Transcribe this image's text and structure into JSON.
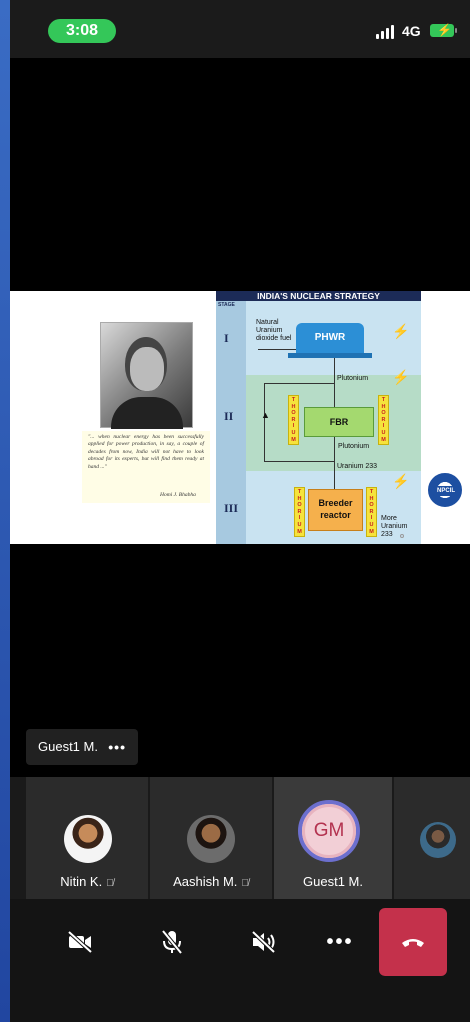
{
  "status_bar": {
    "time": "3:08",
    "network": "4G",
    "icons": [
      "signal-icon",
      "battery-charging-icon"
    ]
  },
  "shared_content": {
    "strategy_title": "INDIA'S NUCLEAR STRATEGY",
    "stage_header": "STAGE",
    "stages": [
      "I",
      "II",
      "III"
    ],
    "natural_uranium_label": "Natural Uranium dioxide fuel",
    "phwr_label": "PHWR",
    "fbr_label": "FBR",
    "breeder_label": "Breeder reactor",
    "plutonium_label_1": "Plutonium",
    "plutonium_label_2": "Plutonium",
    "uranium_label": "Uranium 233",
    "more_uranium_label": "More Uranium 233",
    "thorium_label": "THORIUM",
    "quote": "\"... when nuclear energy has been successfully applied for power production, in say, a couple of decades from now, India will not have to look abroad for its experts, but will find them ready at hand ...\"",
    "quote_author": "Homi J. Bhabha",
    "logo_text": "NPCIL"
  },
  "name_tag": {
    "label": "Guest1 M.",
    "more": "•••"
  },
  "participants": [
    {
      "name": "Nitin K.",
      "muted": true
    },
    {
      "name": "Aashish M.",
      "muted": true
    },
    {
      "name": "Guest1 M.",
      "initials": "GM",
      "muted": false
    },
    {
      "name": "",
      "muted": false
    }
  ],
  "controls": {
    "camera": "camera-off-icon",
    "mic": "mic-off-icon",
    "speaker": "speaker-off-icon",
    "more": "•••",
    "hangup": "hangup-icon"
  },
  "colors": {
    "status_pill": "#34c759",
    "hangup": "#c4314b",
    "active_ring": "#6c6fce",
    "initials_text": "#b3324f"
  }
}
